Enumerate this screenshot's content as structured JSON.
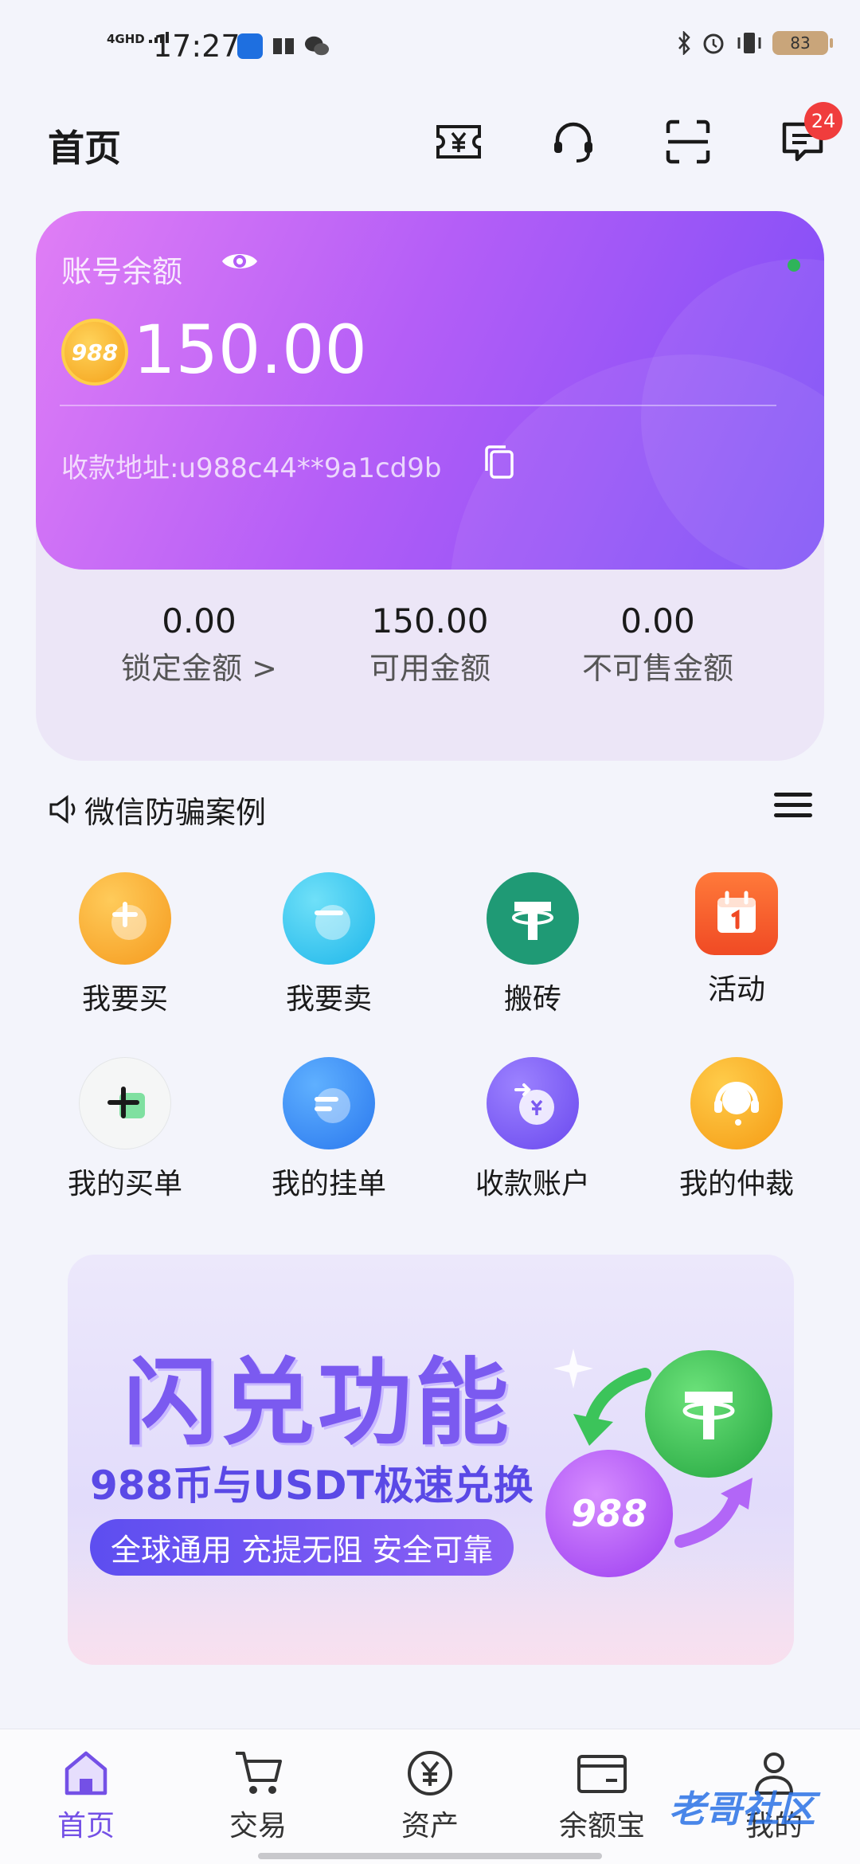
{
  "status_bar": {
    "network": "4GHD",
    "time": "17:27",
    "battery": "83"
  },
  "header": {
    "title": "首页",
    "message_badge": "24"
  },
  "account": {
    "label": "账号余额",
    "coin_label": "988",
    "balance": "150.00",
    "address": "收款地址:u988c44**9a1cd9b"
  },
  "stats": [
    {
      "value": "0.00",
      "label": "锁定金额 >"
    },
    {
      "value": "150.00",
      "label": "可用金额"
    },
    {
      "value": "0.00",
      "label": "不可售金额"
    }
  ],
  "notice": {
    "text": "微信防骗案例"
  },
  "actions": [
    {
      "label": "我要买",
      "icon": "buy-icon",
      "color": "#f7a52a"
    },
    {
      "label": "我要卖",
      "icon": "sell-icon",
      "color": "#2ec5ee"
    },
    {
      "label": "搬砖",
      "icon": "tether-icon",
      "color": "#1f9a75"
    },
    {
      "label": "活动",
      "icon": "calendar-icon",
      "color": "#f25a2b"
    },
    {
      "label": "我的买单",
      "icon": "add-order-icon",
      "color": "#f4f6f5"
    },
    {
      "label": "我的挂单",
      "icon": "list-order-icon",
      "color": "#2e86f4"
    },
    {
      "label": "收款账户",
      "icon": "receive-account-icon",
      "color": "#7b5af0"
    },
    {
      "label": "我的仲裁",
      "icon": "support-agent-icon",
      "color": "#f8a823"
    }
  ],
  "banner": {
    "title": "闪兑功能",
    "subtitle": "988币与USDT极速兑换",
    "tagline": "全球通用 充提无阻 安全可靠",
    "coin_label": "988"
  },
  "tabs": [
    {
      "label": "首页",
      "icon": "home-icon",
      "active": true
    },
    {
      "label": "交易",
      "icon": "cart-icon",
      "active": false
    },
    {
      "label": "资产",
      "icon": "yuan-icon",
      "active": false
    },
    {
      "label": "余额宝",
      "icon": "wallet-card-icon",
      "active": false
    },
    {
      "label": "我的",
      "icon": "profile-icon",
      "active": false
    }
  ],
  "watermark": "老哥社区"
}
